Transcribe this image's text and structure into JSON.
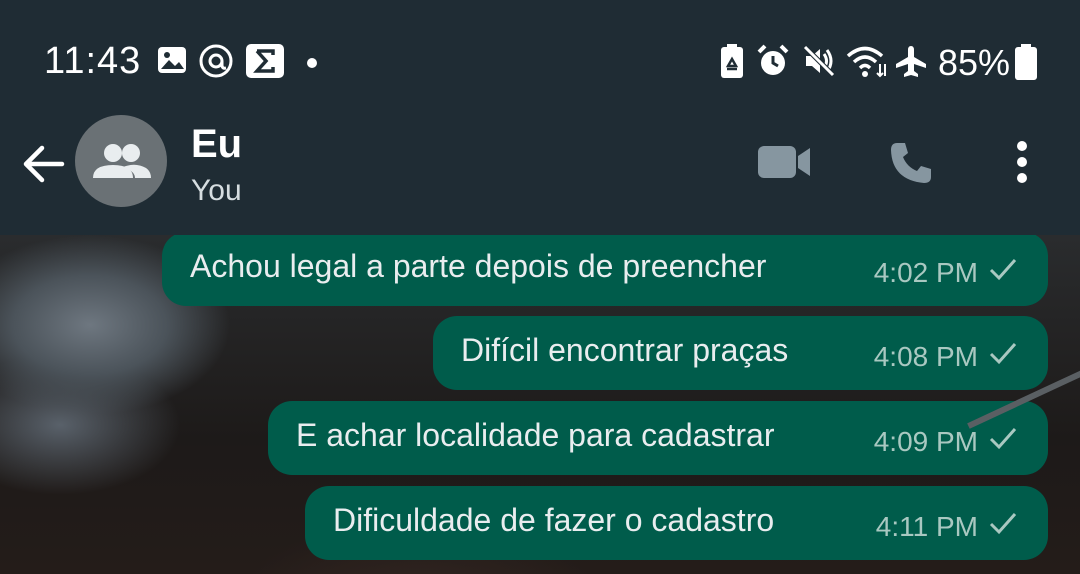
{
  "status_bar": {
    "time": "11:43",
    "battery_percent": "85%",
    "icons": [
      "gallery-icon",
      "threads-icon",
      "sigma-icon",
      "notification-dot-icon",
      "battery-saver-icon",
      "alarm-icon",
      "mute-icon",
      "wifi-icon",
      "airplane-icon",
      "battery-icon"
    ]
  },
  "header": {
    "title": "Eu",
    "subtitle": "You",
    "icons": [
      "back-arrow-icon",
      "group-avatar-icon",
      "video-call-icon",
      "phone-icon",
      "more-vert-icon"
    ]
  },
  "messages": [
    {
      "text": "Achou legal a parte depois de preencher",
      "time": "4:02 PM",
      "status": "sent"
    },
    {
      "text": "Difícil encontrar praças",
      "time": "4:08 PM",
      "status": "sent"
    },
    {
      "text": "E achar localidade para cadastrar",
      "time": "4:09 PM",
      "status": "sent"
    },
    {
      "text": "Dificuldade de fazer o cadastro",
      "time": "4:11 PM",
      "status": "sent"
    }
  ],
  "colors": {
    "header_bg": "#1f2c34",
    "bubble_out": "#005c4b",
    "meta_text": "#a9c8c1",
    "icon_gray": "#8696a0"
  }
}
